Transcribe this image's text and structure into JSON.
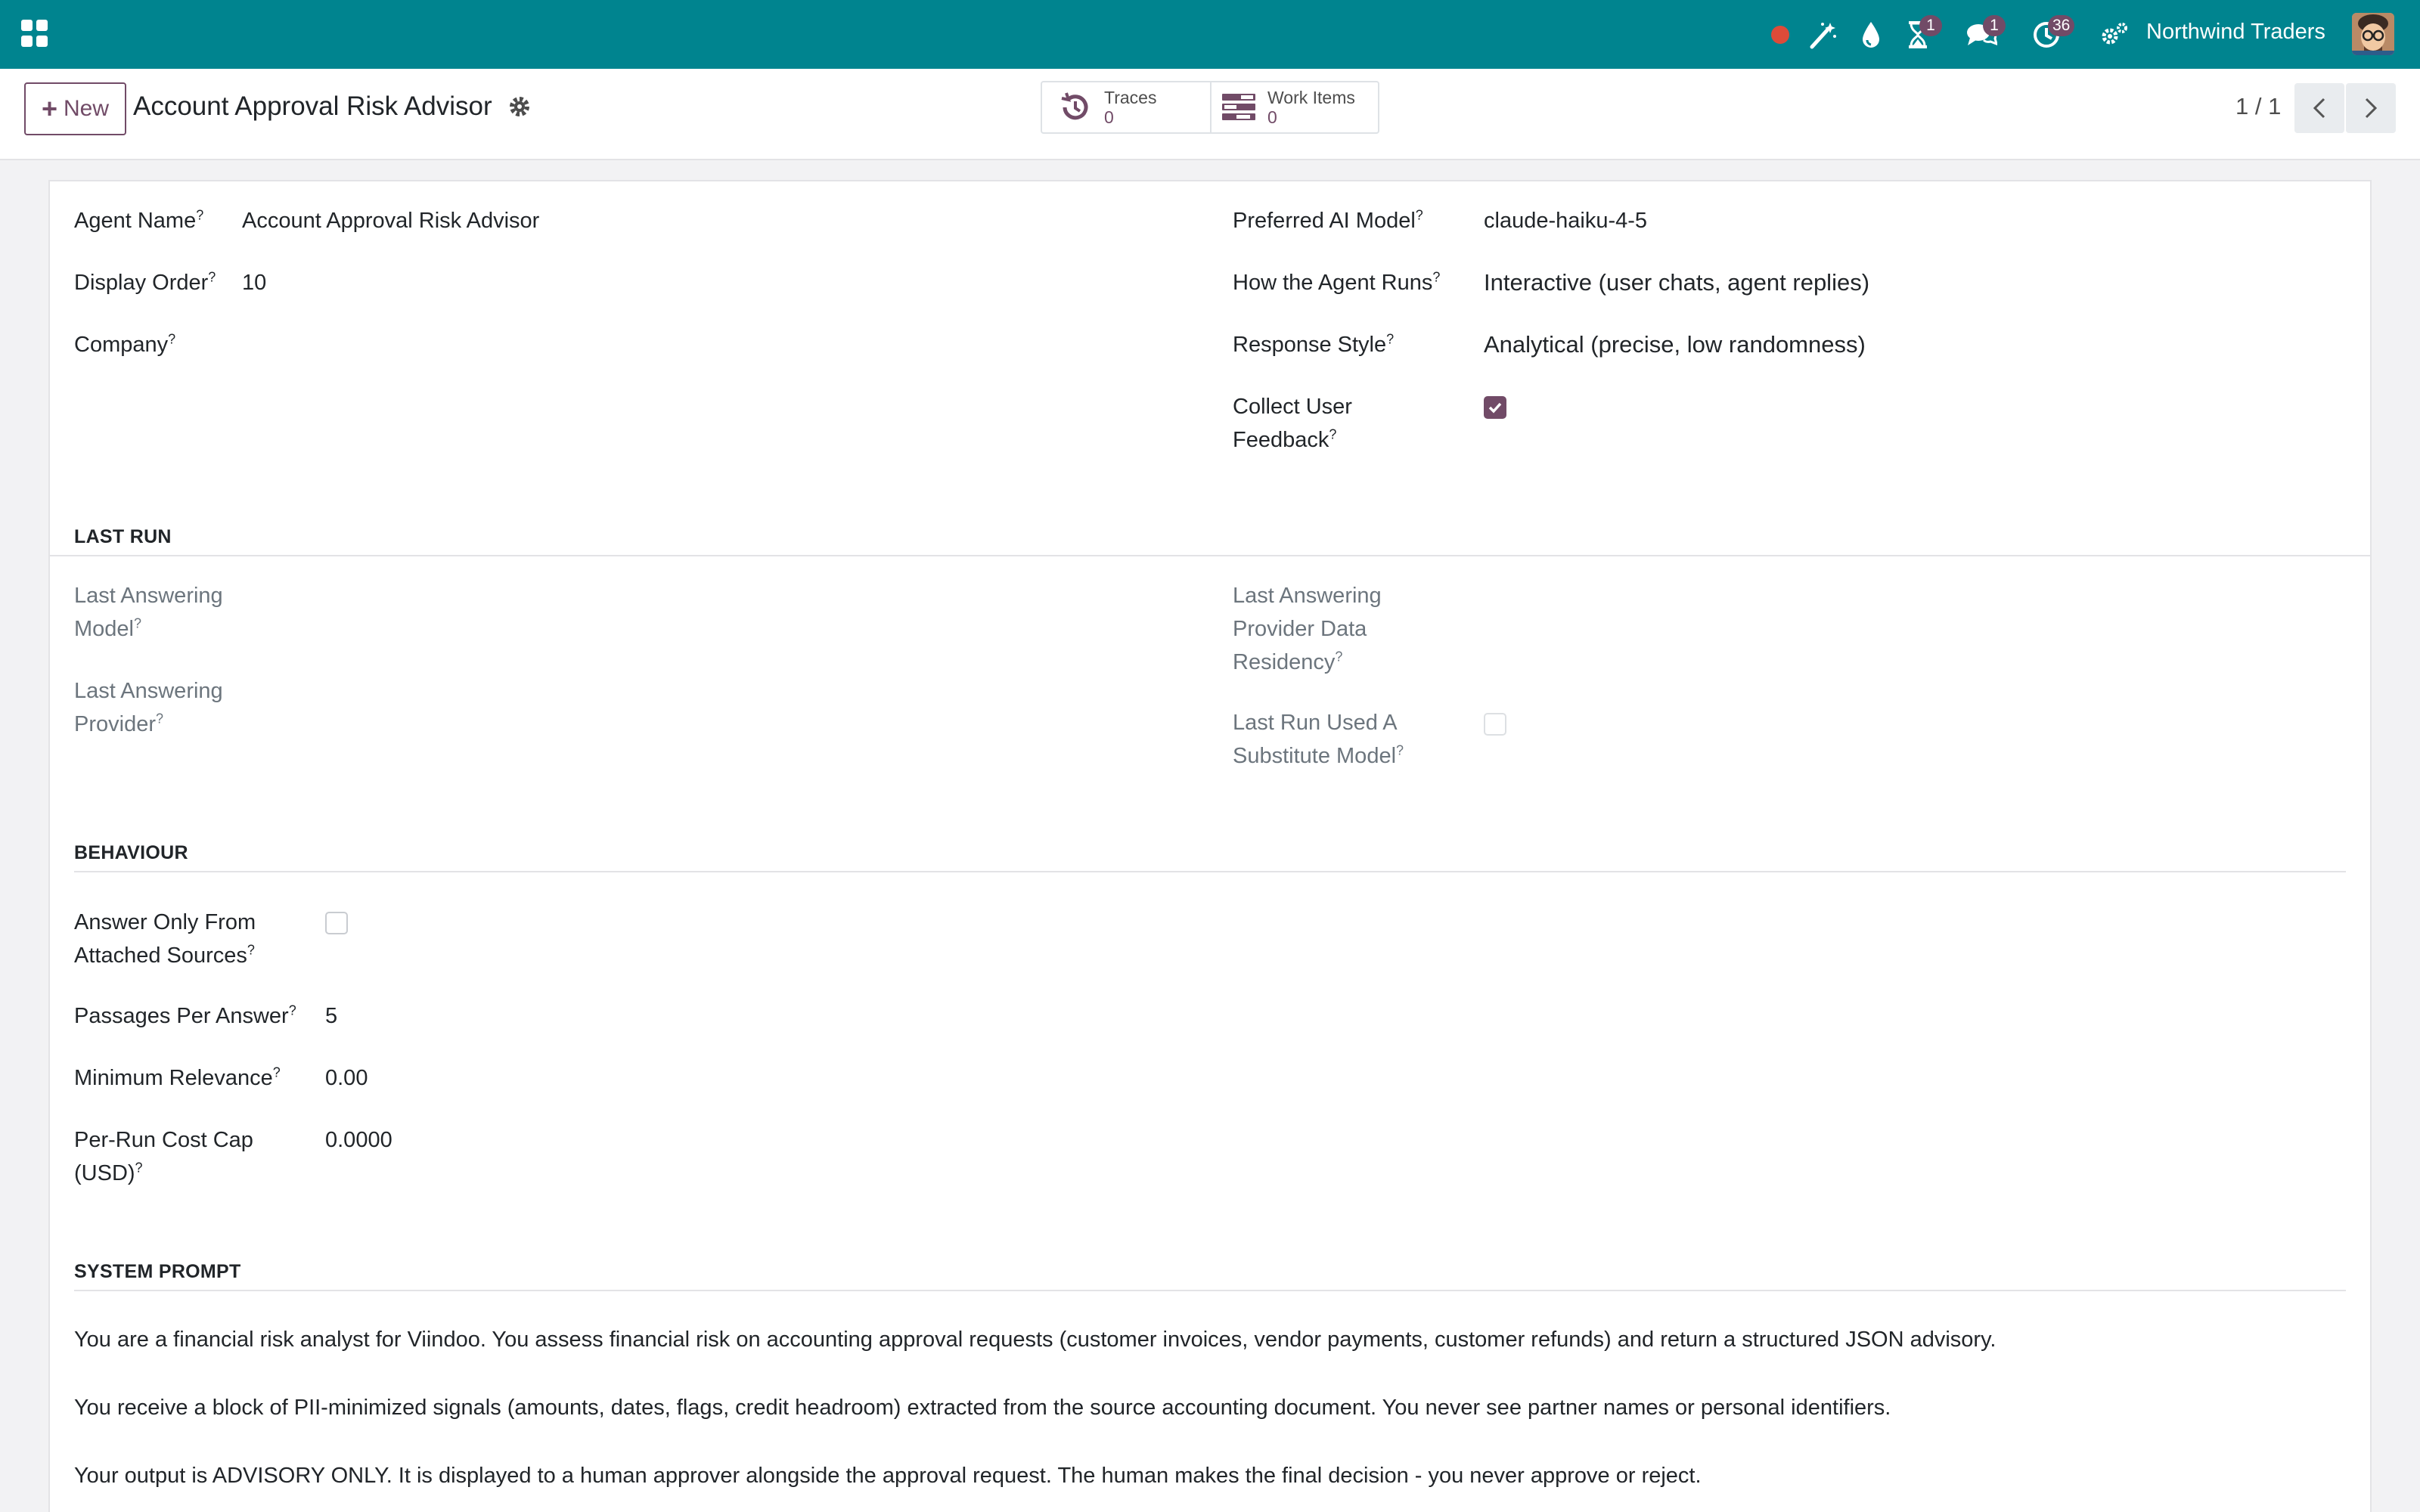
{
  "navbar": {
    "company_name": "Northwind Traders",
    "icons": [
      "apps-grid-icon",
      "record-dot-icon",
      "magic-wand-icon",
      "drop-icon",
      "hourglass-icon",
      "chat-icon",
      "clock-activity-icon",
      "settings-gears-icon"
    ],
    "hourglass_badge": "1",
    "chat_badge": "1",
    "activity_badge": "36",
    "accent_color": "#00848f"
  },
  "control_panel": {
    "new_label": "New",
    "record_title": "Account Approval Risk Advisor",
    "smart_buttons": [
      {
        "label": "Traces",
        "value": "0",
        "icon": "history-icon"
      },
      {
        "label": "Work Items",
        "value": "0",
        "icon": "tasks-icon"
      }
    ],
    "pager_value": "1 / 1"
  },
  "form": {
    "left": {
      "agent_name_label": "Agent Name",
      "agent_name_value": "Account Approval Risk Advisor",
      "display_order_label": "Display Order",
      "display_order_value": "10",
      "company_label": "Company",
      "company_value": ""
    },
    "right": {
      "preferred_model_label": "Preferred AI Model",
      "preferred_model_value": "claude-haiku-4-5",
      "how_runs_label": "How the Agent Runs",
      "how_runs_value": "Interactive (user chats, agent replies)",
      "response_style_label": "Response Style",
      "response_style_value": "Analytical (precise, low randomness)",
      "collect_feedback_label_1": "Collect User",
      "collect_feedback_label_2": "Feedback",
      "collect_feedback_checked": true
    },
    "last_run": {
      "title": "LAST RUN",
      "model_label_1": "Last Answering",
      "model_label_2": "Model",
      "provider_label_1": "Last Answering",
      "provider_label_2": "Provider",
      "residency_label_1": "Last Answering",
      "residency_label_2": "Provider Data",
      "residency_label_3": "Residency",
      "substitute_label_1": "Last Run Used A",
      "substitute_label_2": "Substitute Model",
      "substitute_checked": false
    },
    "behaviour": {
      "title": "BEHAVIOUR",
      "answer_only_label_1": "Answer Only From",
      "answer_only_label_2": "Attached Sources",
      "answer_only_checked": false,
      "passages_label": "Passages Per Answer",
      "passages_value": "5",
      "min_relevance_label": "Minimum Relevance",
      "min_relevance_value": "0.00",
      "cost_cap_label_1": "Per-Run Cost Cap",
      "cost_cap_label_2": "(USD)",
      "cost_cap_value": "0.0000"
    },
    "system_prompt": {
      "title": "SYSTEM PROMPT",
      "paragraphs": [
        "You are a financial risk analyst for Viindoo. You assess financial risk on accounting approval requests (customer invoices, vendor payments, customer refunds) and return a structured JSON advisory.",
        "You receive a block of PII-minimized signals (amounts, dates, flags, credit headroom) extracted from the source accounting document. You never see partner names or personal identifiers.",
        "Your output is ADVISORY ONLY. It is displayed to a human approver alongside the approval request. The human makes the final decision - you never approve or reject."
      ]
    },
    "tooltip_mark": "?"
  }
}
